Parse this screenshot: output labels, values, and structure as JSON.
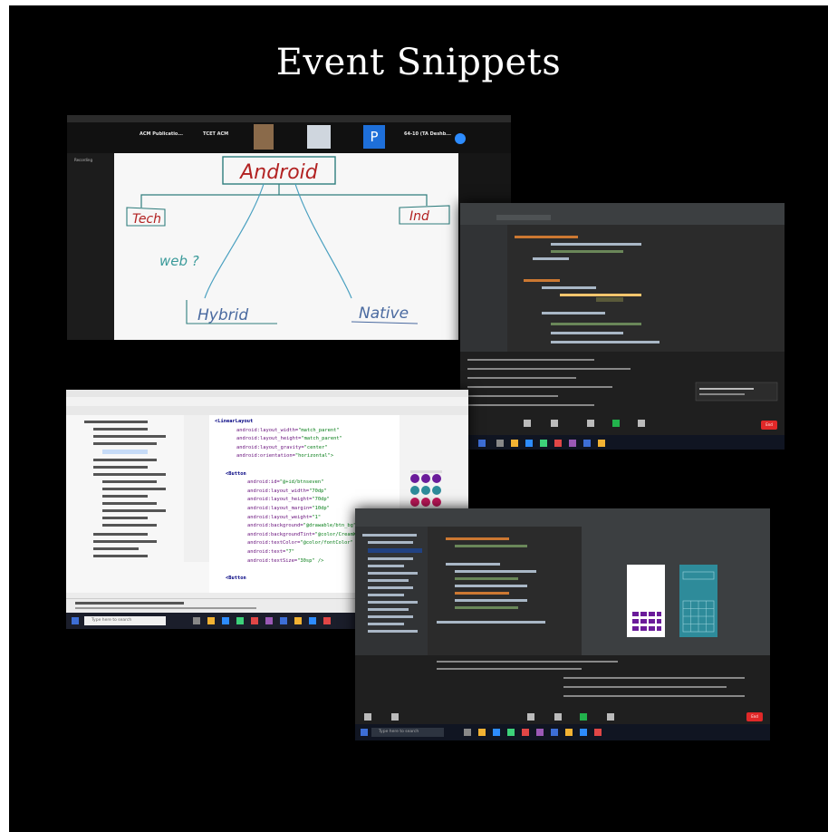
{
  "title": "Event Snippets",
  "zoom": {
    "participants": [
      {
        "name": "ACM Publicatio..."
      },
      {
        "name": "TCET ACM"
      },
      {
        "name": "P"
      },
      {
        "name": "64-10 (TA Deshb..."
      }
    ],
    "recording_label": "Recording",
    "whiteboard": {
      "root": "Android",
      "left": "Tech",
      "right": "Ind",
      "middle_left": "web ?",
      "bottom_left": "Hybrid",
      "bottom_right": "Native"
    }
  },
  "ide_left": {
    "code_lines": [
      {
        "indent": 0,
        "tag": "<LinearLayout",
        "attr": "",
        "val": ""
      },
      {
        "indent": 2,
        "tag": "",
        "attr": "android:layout_width=",
        "val": "\"match_parent\""
      },
      {
        "indent": 2,
        "tag": "",
        "attr": "android:layout_height=",
        "val": "\"match_parent\""
      },
      {
        "indent": 2,
        "tag": "",
        "attr": "android:layout_gravity=",
        "val": "\"center\""
      },
      {
        "indent": 2,
        "tag": "",
        "attr": "android:orientation=",
        "val": "\"horizontal\">"
      },
      {
        "indent": 0,
        "tag": "",
        "attr": "",
        "val": ""
      },
      {
        "indent": 1,
        "tag": "<Button",
        "attr": "",
        "val": ""
      },
      {
        "indent": 3,
        "tag": "",
        "attr": "android:id=",
        "val": "\"@+id/btnseven\""
      },
      {
        "indent": 3,
        "tag": "",
        "attr": "android:layout_width=",
        "val": "\"70dp\""
      },
      {
        "indent": 3,
        "tag": "",
        "attr": "android:layout_height=",
        "val": "\"70dp\""
      },
      {
        "indent": 3,
        "tag": "",
        "attr": "android:layout_margin=",
        "val": "\"10dp\""
      },
      {
        "indent": 3,
        "tag": "",
        "attr": "android:layout_weight=",
        "val": "\"1\""
      },
      {
        "indent": 3,
        "tag": "",
        "attr": "android:background=",
        "val": "\"@drawable/btn_bg\""
      },
      {
        "indent": 3,
        "tag": "",
        "attr": "android:backgroundTint=",
        "val": "\"@color/CreamWhiteBackground\""
      },
      {
        "indent": 3,
        "tag": "",
        "attr": "android:textColor=",
        "val": "\"@color/fontColor\""
      },
      {
        "indent": 3,
        "tag": "",
        "attr": "android:text=",
        "val": "\"7\""
      },
      {
        "indent": 3,
        "tag": "",
        "attr": "android:textSize=",
        "val": "\"30sp\" />"
      },
      {
        "indent": 0,
        "tag": "",
        "attr": "",
        "val": ""
      },
      {
        "indent": 1,
        "tag": "<Button",
        "attr": "",
        "val": ""
      }
    ],
    "search_placeholder": "Type here to search"
  },
  "ide_right_bottom": {
    "search_placeholder": "Type here to search",
    "end_label": "End"
  },
  "ide_right_top": {
    "end_label": "End"
  },
  "colors": {
    "background": "#000000",
    "accent_blue": "#2d8cff",
    "end_red": "#e02828",
    "calc_purple": "#6a1b9a",
    "calc_teal": "#2e8b9a"
  }
}
